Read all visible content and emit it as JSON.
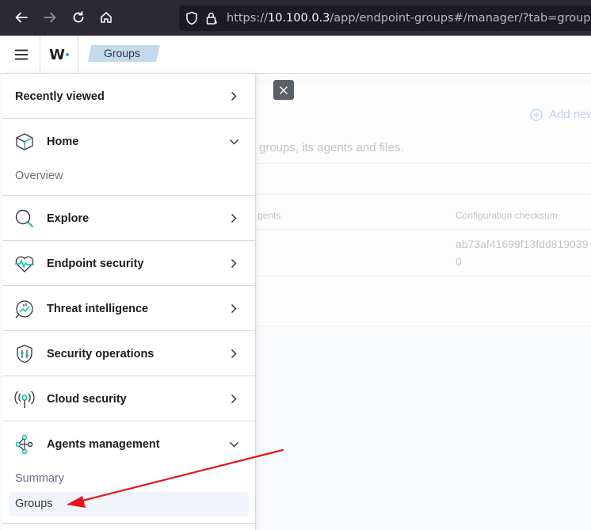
{
  "browser": {
    "url_prefix": "https://",
    "url_host": "10.100.0.3",
    "url_path": "/app/endpoint-groups#/manager/?tab=groups",
    "back_icon": "arrow-left-icon",
    "forward_icon": "arrow-right-icon",
    "reload_icon": "reload-icon",
    "home_icon": "home-icon"
  },
  "header": {
    "logo_text": "W",
    "breadcrumb": "Groups"
  },
  "background": {
    "add_new": "Add new",
    "description": "groups, its agents and files.",
    "col_agents": "gents",
    "col_checksum": "Configuration checksum",
    "checksum_value": "ab73af41699f13fdd819039",
    "agents_value": "0"
  },
  "nav": {
    "recently_viewed": "Recently viewed",
    "home": "Home",
    "home_sub": [
      "Overview"
    ],
    "explore": "Explore",
    "endpoint_security": "Endpoint security",
    "threat_intelligence": "Threat intelligence",
    "security_operations": "Security operations",
    "cloud_security": "Cloud security",
    "agents_management": "Agents management",
    "agents_sub": [
      "Summary",
      "Groups"
    ]
  },
  "colors": {
    "chrome_bg": "#2b2a33",
    "url_bg": "#1c1b22",
    "breadcrumb_bg": "#c2d9ee",
    "accent_teal": "#00bfb3",
    "annotation_red": "#e8141b"
  }
}
